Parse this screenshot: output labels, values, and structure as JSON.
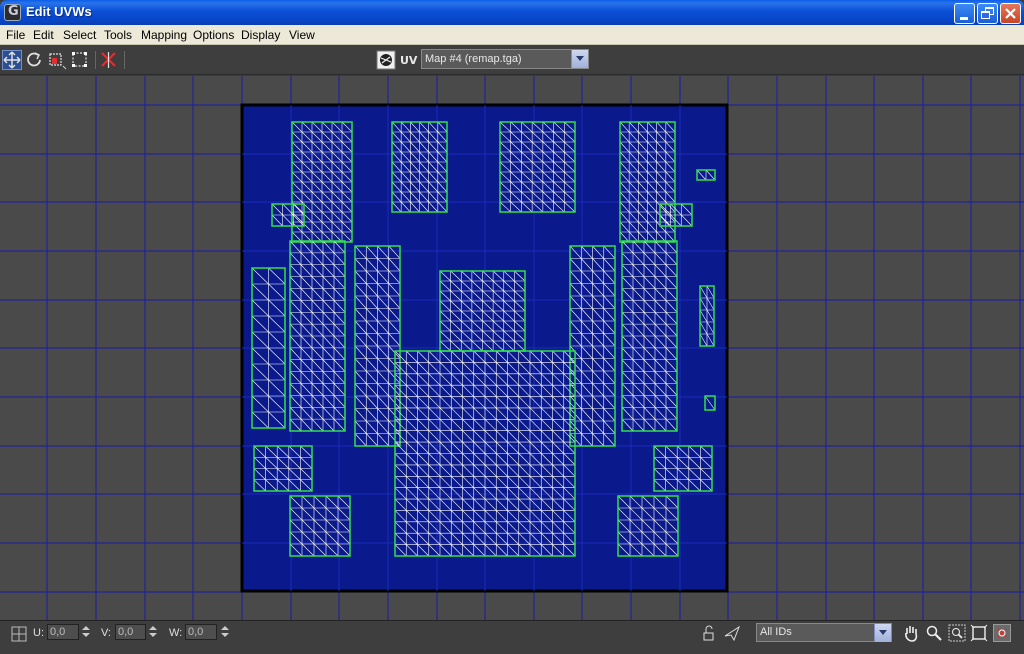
{
  "window": {
    "title": "Edit UVWs"
  },
  "menu": [
    "File",
    "Edit",
    "Select",
    "Tools",
    "Mapping",
    "Options",
    "Display",
    "View"
  ],
  "toolbar": {
    "uv_label": "UV",
    "map_selector": {
      "selected": "Map #4 (remap.tga)"
    }
  },
  "status": {
    "u_label": "U:",
    "u_value": "0,0",
    "v_label": "V:",
    "v_value": "0,0",
    "w_label": "W:",
    "w_value": "0,0",
    "ids_selector": {
      "selected": "All IDs"
    }
  },
  "colors": {
    "grid_line": "#1a1aa8",
    "texture_bg": "#0a1a8c",
    "mesh_edge": "#ffffff",
    "seam_edge": "#2fe04a"
  },
  "icons": {
    "move": "move-icon",
    "rotate": "rotate-icon",
    "scale": "scale-icon",
    "freeform": "freeform-icon",
    "mirror": "mirror-icon",
    "texture": "show-map-icon",
    "pan": "pan-icon",
    "zoom": "zoom-icon",
    "zoom_region": "zoom-region-icon",
    "zoom_extents": "zoom-extents-icon",
    "snap": "snap-icon"
  }
}
